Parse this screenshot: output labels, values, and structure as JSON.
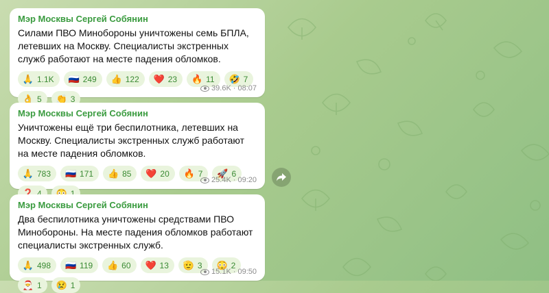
{
  "messages": [
    {
      "author": "Мэр Москвы Сергей Собянин",
      "text": "Силами ПВО Минобороны уничтожены семь БПЛА, летевших на Москву. Специалисты экстренных служб работают на месте падения обломков.",
      "reactions": [
        {
          "emoji": "🙏",
          "count": "1.1K",
          "icon": "pray-icon"
        },
        {
          "emoji": "🇷🇺",
          "count": "249",
          "icon": "russia-flag-icon"
        },
        {
          "emoji": "👍",
          "count": "122",
          "icon": "thumbs-up-icon"
        },
        {
          "emoji": "❤️",
          "count": "23",
          "icon": "heart-icon"
        },
        {
          "emoji": "🔥",
          "count": "11",
          "icon": "fire-icon"
        },
        {
          "emoji": "🤣",
          "count": "7",
          "icon": "laughing-face-icon"
        },
        {
          "emoji": "👌",
          "count": "5",
          "icon": "ok-hand-icon"
        },
        {
          "emoji": "👏",
          "count": "3",
          "icon": "clapping-icon"
        }
      ],
      "views": "39.6K",
      "time": "08:07"
    },
    {
      "author": "Мэр Москвы Сергей Собянин",
      "text": "Уничтожены ещё три беспилотника, летевших на Москву. Специалисты экстренных служб работают на месте падения обломков.",
      "reactions": [
        {
          "emoji": "🙏",
          "count": "783",
          "icon": "pray-icon"
        },
        {
          "emoji": "🇷🇺",
          "count": "171",
          "icon": "russia-flag-icon"
        },
        {
          "emoji": "👍",
          "count": "85",
          "icon": "thumbs-up-icon"
        },
        {
          "emoji": "❤️",
          "count": "20",
          "icon": "heart-icon"
        },
        {
          "emoji": "🔥",
          "count": "7",
          "icon": "fire-icon"
        },
        {
          "emoji": "🚀",
          "count": "6",
          "icon": "rocket-icon"
        },
        {
          "emoji": "❓",
          "count": "4",
          "icon": "question-icon"
        },
        {
          "emoji": "😳",
          "count": "1",
          "icon": "flushed-face-icon"
        }
      ],
      "views": "25.4K",
      "time": "09:20"
    },
    {
      "author": "Мэр Москвы Сергей Собянин",
      "text": "Два беспилотника уничтожены средствами ПВО Минобороны. На месте падения обломков работают специалисты экстренных служб.",
      "reactions": [
        {
          "emoji": "🙏",
          "count": "498",
          "icon": "pray-icon"
        },
        {
          "emoji": "🇷🇺",
          "count": "119",
          "icon": "russia-flag-icon"
        },
        {
          "emoji": "👍",
          "count": "60",
          "icon": "thumbs-up-icon"
        },
        {
          "emoji": "❤️",
          "count": "13",
          "icon": "heart-icon"
        },
        {
          "emoji": "🫡",
          "count": "3",
          "icon": "salute-face-icon"
        },
        {
          "emoji": "😳",
          "count": "2",
          "icon": "flushed-face-icon"
        },
        {
          "emoji": "🎅",
          "count": "1",
          "icon": "santa-icon"
        },
        {
          "emoji": "😢",
          "count": "1",
          "icon": "crying-face-icon"
        }
      ],
      "views": "15.1K",
      "time": "09:50"
    }
  ],
  "colors": {
    "author": "#3a9b3f",
    "reaction_bg": "#e9f4dd",
    "reaction_text": "#3a8a33",
    "meta": "#8b8b8b"
  },
  "forward_button": {
    "icon": "share-arrow-icon"
  }
}
